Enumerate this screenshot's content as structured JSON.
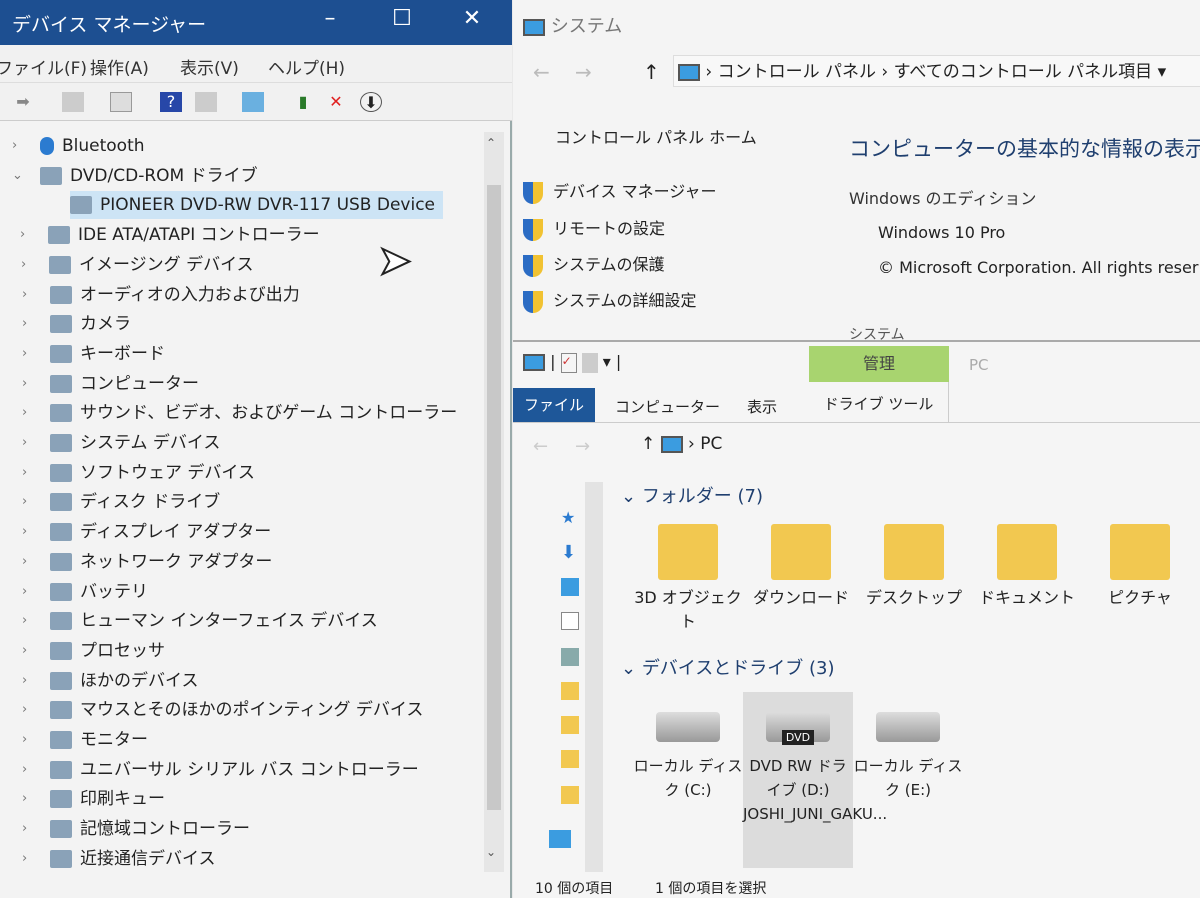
{
  "device_manager": {
    "title": "デバイス マネージャー",
    "menu": [
      "ファイル(F)",
      "操作(A)",
      "表示(V)",
      "ヘルプ(H)"
    ],
    "tree": [
      {
        "label": "Bluetooth",
        "level": 0,
        "expanded": false
      },
      {
        "label": "DVD/CD-ROM ドライブ",
        "level": 0,
        "expanded": true
      },
      {
        "label": "PIONEER DVD-RW  DVR-117 USB Device",
        "level": 1,
        "selected": true
      },
      {
        "label": "IDE ATA/ATAPI コントローラー",
        "level": 0
      },
      {
        "label": "イメージング デバイス",
        "level": 0
      },
      {
        "label": "オーディオの入力および出力",
        "level": 0
      },
      {
        "label": "カメラ",
        "level": 0
      },
      {
        "label": "キーボード",
        "level": 0
      },
      {
        "label": "コンピューター",
        "level": 0
      },
      {
        "label": "サウンド、ビデオ、およびゲーム コントローラー",
        "level": 0
      },
      {
        "label": "システム デバイス",
        "level": 0
      },
      {
        "label": "ソフトウェア デバイス",
        "level": 0
      },
      {
        "label": "ディスク ドライブ",
        "level": 0
      },
      {
        "label": "ディスプレイ アダプター",
        "level": 0
      },
      {
        "label": "ネットワーク アダプター",
        "level": 0
      },
      {
        "label": "バッテリ",
        "level": 0
      },
      {
        "label": "ヒューマン インターフェイス デバイス",
        "level": 0
      },
      {
        "label": "プロセッサ",
        "level": 0
      },
      {
        "label": "ほかのデバイス",
        "level": 0
      },
      {
        "label": "マウスとそのほかのポインティング デバイス",
        "level": 0
      },
      {
        "label": "モニター",
        "level": 0
      },
      {
        "label": "ユニバーサル シリアル バス コントローラー",
        "level": 0
      },
      {
        "label": "印刷キュー",
        "level": 0
      },
      {
        "label": "記憶域コントローラー",
        "level": 0
      },
      {
        "label": "近接通信デバイス",
        "level": 0
      }
    ]
  },
  "system": {
    "title": "システム",
    "breadcrumb": [
      "コントロール パネル",
      "すべてのコントロール パネル項目"
    ],
    "home": "コントロール パネル ホーム",
    "links": [
      "デバイス マネージャー",
      "リモートの設定",
      "システムの保護",
      "システムの詳細設定"
    ],
    "heading": "コンピューターの基本的な情報の表示",
    "edition_label": "Windows のエディション",
    "edition": "Windows 10 Pro",
    "copyright": "© Microsoft Corporation. All rights reser",
    "section": "システム"
  },
  "explorer": {
    "context_tab": "管理",
    "window_title": "PC",
    "tabs": [
      "ファイル",
      "コンピューター",
      "表示",
      "ドライブ ツール"
    ],
    "path": "PC",
    "folders_header": "フォルダー (7)",
    "folders": [
      "3D オブジェクト",
      "ダウンロード",
      "デスクトップ",
      "ドキュメント",
      "ピクチャ"
    ],
    "devices_header": "デバイスとドライブ (3)",
    "drives": [
      {
        "name": "ローカル ディスク (C:)"
      },
      {
        "name": "DVD RW ドライブ (D:) JOSHI_JUNI_GAKU...",
        "badge": "DVD"
      },
      {
        "name": "ローカル ディスク (E:)"
      }
    ],
    "status_items": "10 個の項目",
    "status_selected": "1 個の項目を選択"
  }
}
